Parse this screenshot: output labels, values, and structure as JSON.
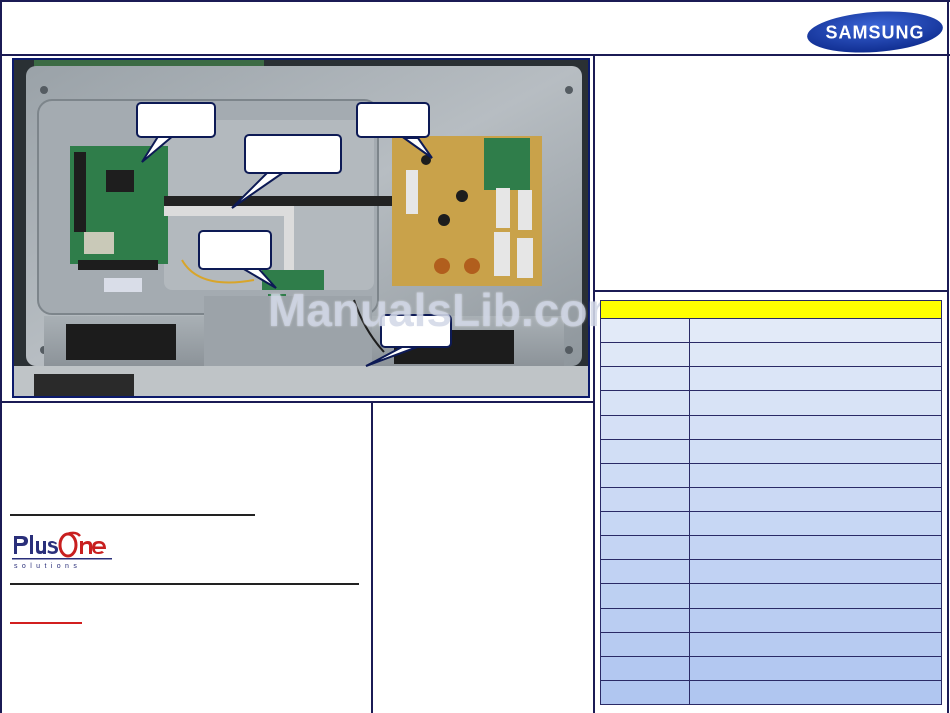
{
  "brand": {
    "name": "SAMSUNG",
    "color": "#1b3fae"
  },
  "photo": {
    "icon": "tv-rear-internal-boards-photo",
    "callout_count": 5
  },
  "watermark": {
    "text": "ManualsLib.com"
  },
  "partner_logo": {
    "name": "PlusOne Solutions",
    "accent": "#c81f1f",
    "text_color": "#2a2f7a"
  },
  "parts_table": {
    "header_color": "#ffff00",
    "row_count": 17
  }
}
